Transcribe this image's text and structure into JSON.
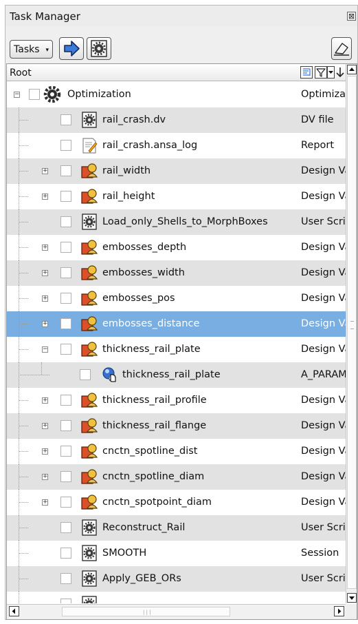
{
  "window": {
    "title": "Task Manager",
    "close_label": "⊠"
  },
  "toolbar": {
    "tasks_label": "Tasks",
    "tasks_caret": "▾",
    "colors": {
      "arrow_blue": "#3a7ad9"
    }
  },
  "tree": {
    "root_label": "Root",
    "selected_index": 9,
    "colors": {
      "selected": "#78aee1",
      "shaded": "#e2e2e2"
    },
    "rows": [
      {
        "name": "Optimization",
        "type": "Optimization",
        "icon": "gear-large-icon",
        "level": 0,
        "expander": "minus",
        "shaded": false
      },
      {
        "name": "rail_crash.dv",
        "type": "DV file",
        "icon": "gear-script-icon",
        "level": 1,
        "expander": "none",
        "shaded": true
      },
      {
        "name": "rail_crash.ansa_log",
        "type": "Report",
        "icon": "report-icon",
        "level": 1,
        "expander": "none",
        "shaded": false
      },
      {
        "name": "rail_width",
        "type": "Design Variable",
        "icon": "design-variable-icon",
        "level": 1,
        "expander": "plus",
        "shaded": true
      },
      {
        "name": "rail_height",
        "type": "Design Variable",
        "icon": "design-variable-icon",
        "level": 1,
        "expander": "plus",
        "shaded": false
      },
      {
        "name": "Load_only_Shells_to_MorphBoxes",
        "type": "User Script",
        "icon": "gear-script-icon",
        "level": 1,
        "expander": "none",
        "shaded": true
      },
      {
        "name": "embosses_depth",
        "type": "Design Variable",
        "icon": "design-variable-icon",
        "level": 1,
        "expander": "plus",
        "shaded": false
      },
      {
        "name": "embosses_width",
        "type": "Design Variable",
        "icon": "design-variable-icon",
        "level": 1,
        "expander": "plus",
        "shaded": true
      },
      {
        "name": "embosses_pos",
        "type": "Design Variable",
        "icon": "design-variable-icon",
        "level": 1,
        "expander": "plus",
        "shaded": false
      },
      {
        "name": "embosses_distance",
        "type": "Design Variable",
        "icon": "design-variable-icon",
        "level": 1,
        "expander": "plus",
        "shaded": true
      },
      {
        "name": "thickness_rail_plate",
        "type": "Design Variable",
        "icon": "design-variable-icon",
        "level": 1,
        "expander": "minus",
        "shaded": false
      },
      {
        "name": "thickness_rail_plate",
        "type": "A_PARAMETER",
        "icon": "parameter-icon",
        "level": 2,
        "expander": "none",
        "shaded": true
      },
      {
        "name": "thickness_rail_profile",
        "type": "Design Variable",
        "icon": "design-variable-icon",
        "level": 1,
        "expander": "plus",
        "shaded": false
      },
      {
        "name": "thickness_rail_flange",
        "type": "Design Variable",
        "icon": "design-variable-icon",
        "level": 1,
        "expander": "plus",
        "shaded": true
      },
      {
        "name": "cnctn_spotline_dist",
        "type": "Design Variable",
        "icon": "design-variable-icon",
        "level": 1,
        "expander": "plus",
        "shaded": false
      },
      {
        "name": "cnctn_spotline_diam",
        "type": "Design Variable",
        "icon": "design-variable-icon",
        "level": 1,
        "expander": "plus",
        "shaded": true
      },
      {
        "name": "cnctn_spotpoint_diam",
        "type": "Design Variable",
        "icon": "design-variable-icon",
        "level": 1,
        "expander": "plus",
        "shaded": false
      },
      {
        "name": "Reconstruct_Rail",
        "type": "User Script",
        "icon": "gear-script-icon",
        "level": 1,
        "expander": "none",
        "shaded": true
      },
      {
        "name": "SMOOTH",
        "type": "Session",
        "icon": "gear-script-icon",
        "level": 1,
        "expander": "none",
        "shaded": false
      },
      {
        "name": "Apply_GEB_ORs",
        "type": "User Script",
        "icon": "gear-script-icon",
        "level": 1,
        "expander": "none",
        "shaded": true
      },
      {
        "name": "",
        "type": "",
        "icon": "gear-script-icon",
        "level": 1,
        "expander": "none",
        "shaded": false
      }
    ]
  }
}
